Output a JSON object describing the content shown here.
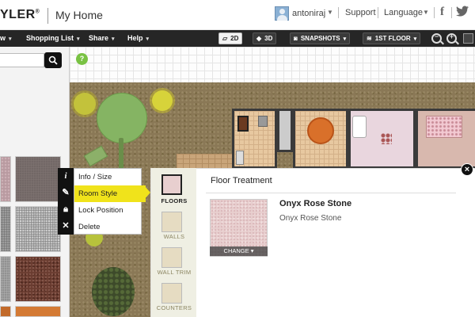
{
  "header": {
    "logo_text": "YLER",
    "logo_mark": "®",
    "page_title": "My Home",
    "username": "antoniraj",
    "support_label": "Support",
    "language_label": "Language",
    "facebook_icon": "f"
  },
  "toolbar": {
    "menu": [
      {
        "label": "w"
      },
      {
        "label": "Shopping List"
      },
      {
        "label": "Share"
      },
      {
        "label": "Help"
      }
    ],
    "view_2d": "2D",
    "view_3d": "3D",
    "snapshots": "SNAPSHOTS",
    "floor": "1ST FLOOR"
  },
  "left_panel": {
    "search_placeholder": ""
  },
  "canvas": {
    "help_label": "?"
  },
  "context_menu": {
    "items": [
      {
        "icon": "i",
        "label": "Info / Size"
      },
      {
        "icon": "brush",
        "label": "Room Style"
      },
      {
        "icon": "lock",
        "label": "Lock Position"
      },
      {
        "icon": "x",
        "label": "Delete"
      }
    ],
    "selected_index": 1
  },
  "categories": [
    {
      "label": "FLOORS",
      "active": true
    },
    {
      "label": "WALLS",
      "active": false
    },
    {
      "label": "WALL TRIM",
      "active": false
    },
    {
      "label": "COUNTERS",
      "active": false
    }
  ],
  "floor_panel": {
    "title": "Floor Treatment",
    "material_name": "Onyx Rose Stone",
    "material_subtitle": "Onyx Rose Stone",
    "change_label": "CHANGE ▾",
    "close_label": "×"
  },
  "colors": {
    "toolbar_bg": "#262626",
    "selection_yellow": "#f0e31b",
    "swatch_pink": "#e8cfcf"
  }
}
